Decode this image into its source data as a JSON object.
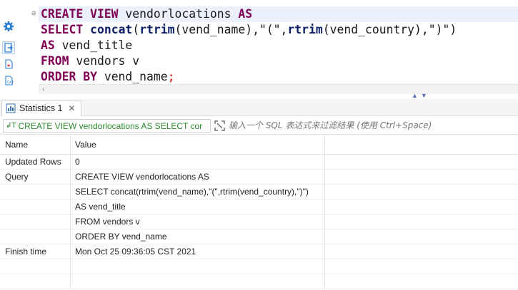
{
  "editor": {
    "fold_marker": "⊖",
    "lines": [
      [
        {
          "t": "CREATE VIEW",
          "c": "kw"
        },
        {
          "t": " vendorlocations ",
          "c": ""
        },
        {
          "t": "AS",
          "c": "kw"
        }
      ],
      [
        {
          "t": "SELECT",
          "c": "kw"
        },
        {
          "t": " ",
          "c": ""
        },
        {
          "t": "concat",
          "c": "fn"
        },
        {
          "t": "(",
          "c": ""
        },
        {
          "t": "rtrim",
          "c": "fn"
        },
        {
          "t": "(vend_name),\"(\",",
          "c": ""
        },
        {
          "t": "rtrim",
          "c": "fn"
        },
        {
          "t": "(vend_country),\")\")",
          "c": ""
        }
      ],
      [
        {
          "t": "AS",
          "c": "kw"
        },
        {
          "t": " vend_title",
          "c": ""
        }
      ],
      [
        {
          "t": "FROM",
          "c": "kw"
        },
        {
          "t": " vendors v",
          "c": ""
        }
      ],
      [
        {
          "t": "ORDER BY",
          "c": "kw"
        },
        {
          "t": " vend_name",
          "c": ""
        },
        {
          "t": ";",
          "c": "semi"
        }
      ]
    ],
    "scroll_left_glyph": "‹",
    "nav_arrows": "▲▼"
  },
  "side_tools": [
    {
      "icon": "gear-icon",
      "color": "#2a7fd4"
    },
    {
      "icon": "execute-script-icon",
      "color": "#2a7fd4"
    },
    {
      "icon": "export-file-icon",
      "color": "#2a7fd4"
    },
    {
      "icon": "variables-icon",
      "color": "#2a7fd4"
    }
  ],
  "tab": {
    "label": "Statistics 1",
    "close": "✕"
  },
  "filter": {
    "query_text": "CREATE VIEW vendorlocations AS SELECT cor",
    "query_icon": "↲T",
    "placeholder": "输入一个 SQL 表达式来过滤结果 (使用 Ctrl+Space)"
  },
  "table": {
    "headers": [
      "Name",
      "Value"
    ],
    "rows": [
      {
        "name": "Updated Rows",
        "value": "0"
      },
      {
        "name": "Query",
        "value": "CREATE VIEW vendorlocations AS"
      },
      {
        "name": "",
        "value": "SELECT concat(rtrim(vend_name),\"(\",rtrim(vend_country),\")\")"
      },
      {
        "name": "",
        "value": "AS vend_title"
      },
      {
        "name": "",
        "value": "FROM vendors v"
      },
      {
        "name": "",
        "value": "ORDER BY vend_name"
      },
      {
        "name": "Finish time",
        "value": "Mon Oct 25 09:36:05 CST 2021"
      },
      {
        "name": "",
        "value": ""
      },
      {
        "name": "",
        "value": ""
      }
    ]
  },
  "colors": {
    "keyword": "#7f0055",
    "function": "#0b1f66",
    "accent": "#2a7fd4",
    "query_text": "#2c8a2c"
  }
}
